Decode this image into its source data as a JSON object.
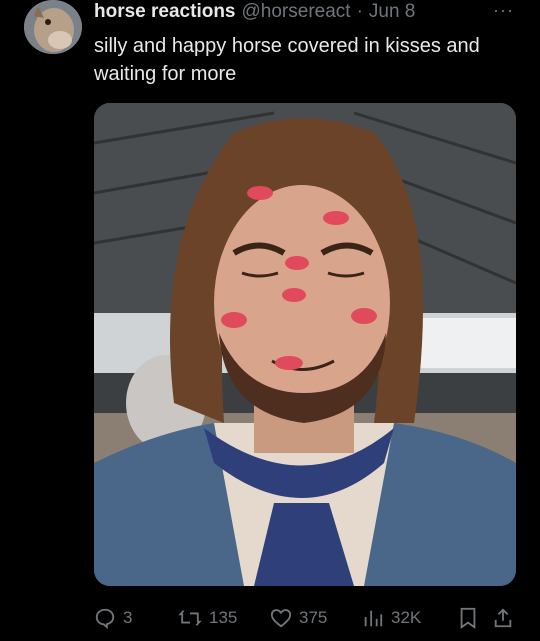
{
  "tweet": {
    "display_name": "horse reactions",
    "handle": "@horsereact",
    "separator": "·",
    "date": "Jun 8",
    "more_label": "···",
    "text": "silly and happy horse covered in kisses and waiting for more"
  },
  "media": {
    "icon": "image",
    "description_icon": "man-with-kiss-marks-drawing-over-horse-photo"
  },
  "actions": {
    "replies": "3",
    "retweets": "135",
    "likes": "375",
    "views": "32K"
  },
  "colors": {
    "background": "#000000",
    "text": "#e7e9ea",
    "muted": "#71767b"
  }
}
